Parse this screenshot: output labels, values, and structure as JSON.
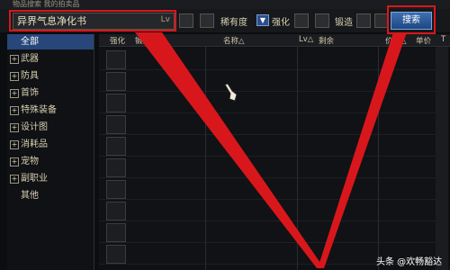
{
  "title": "物品搜索  我的拍卖品",
  "search": {
    "value": "异界气息净化书",
    "lv_label": "Lv"
  },
  "filters": {
    "rarity_label": "稀有度",
    "enhance_label": "强化",
    "forge_label": "锻造"
  },
  "search_button": "搜索",
  "categories": [
    {
      "label": "全部",
      "selected": true,
      "expandable": false
    },
    {
      "label": "武器",
      "selected": false,
      "expandable": true
    },
    {
      "label": "防具",
      "selected": false,
      "expandable": true
    },
    {
      "label": "首饰",
      "selected": false,
      "expandable": true
    },
    {
      "label": "特殊装备",
      "selected": false,
      "expandable": true
    },
    {
      "label": "设计图",
      "selected": false,
      "expandable": true
    },
    {
      "label": "消耗品",
      "selected": false,
      "expandable": true
    },
    {
      "label": "宠物",
      "selected": false,
      "expandable": true
    },
    {
      "label": "副职业",
      "selected": false,
      "expandable": true
    },
    {
      "label": "其他",
      "selected": false,
      "expandable": false
    }
  ],
  "columns": [
    "强化",
    "锻造△",
    "名称△",
    "Lv△",
    "剩余",
    "价格△",
    "单价",
    "T"
  ],
  "row_count": 10,
  "watermark": "头条 @欢畅豁达",
  "colors": {
    "highlight": "#d8171c",
    "selected": "#27467a",
    "button": "#2f5c9e"
  }
}
